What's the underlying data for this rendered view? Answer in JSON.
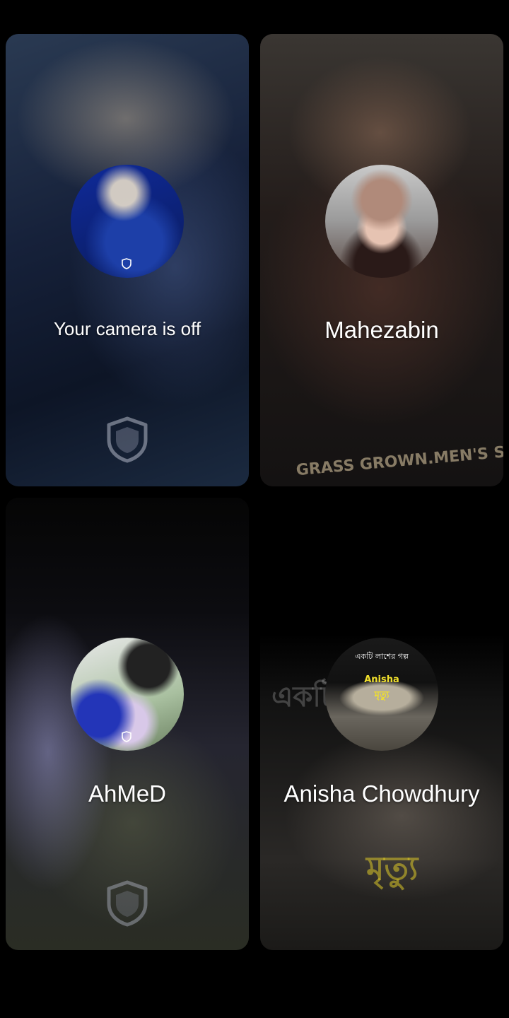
{
  "participants": [
    {
      "name": "Your camera is off",
      "avatar_icon": "profile-photo"
    },
    {
      "name": "Mahezabin",
      "avatar_icon": "profile-photo",
      "shirt_text": "GRASS GROWN.MEN'S SIZE AT SHIRIS"
    },
    {
      "name": "AhMeD",
      "avatar_icon": "profile-photo"
    },
    {
      "name": "Anisha Chowdhury",
      "avatar_icon": "profile-photo",
      "avatar_text_top": "একটি লাশের গল্প",
      "avatar_text_name": "Anisha",
      "avatar_text_bottom": "মৃত্যু",
      "bg_text_1": "একটি",
      "bg_text_2": "মৃত্যু"
    }
  ],
  "icons": {
    "secure": "shield-icon"
  },
  "colors": {
    "background": "#000000",
    "text": "#ffffff",
    "accent_yellow": "#f1e02c"
  }
}
